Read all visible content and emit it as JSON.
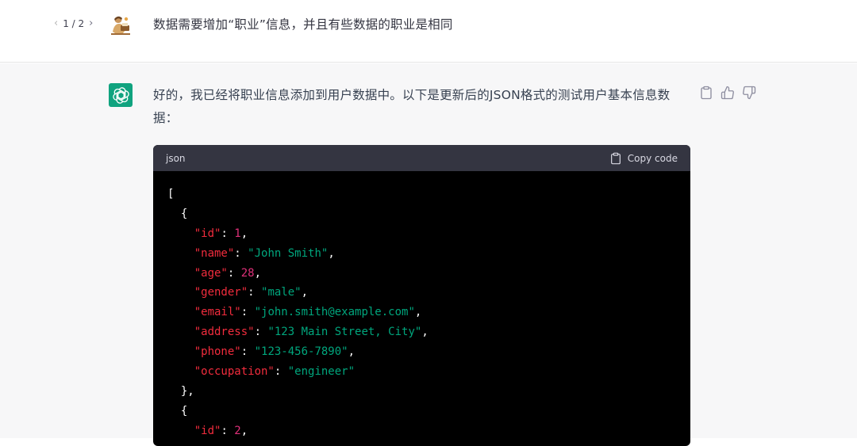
{
  "user_message": {
    "pager": {
      "prev": "‹",
      "label": "1 / 2",
      "next": "›"
    },
    "text": "数据需要增加“职业”信息，并且有些数据的职业是相同"
  },
  "assistant_message": {
    "text": "好的，我已经将职业信息添加到用户数据中。以下是更新后的JSON格式的测试用户基本信息数据：",
    "actions": [
      "clipboard-icon",
      "thumbs-up-icon",
      "thumbs-down-icon"
    ],
    "brand_color": "#10a37f"
  },
  "code_block": {
    "language": "json",
    "copy_label": "Copy code",
    "lines": [
      [
        {
          "t": "p",
          "v": "["
        }
      ],
      [
        {
          "t": "p",
          "v": "  {"
        }
      ],
      [
        {
          "t": "p",
          "v": "    "
        },
        {
          "t": "k",
          "v": "\"id\""
        },
        {
          "t": "p",
          "v": ": "
        },
        {
          "t": "n",
          "v": "1"
        },
        {
          "t": "p",
          "v": ","
        }
      ],
      [
        {
          "t": "p",
          "v": "    "
        },
        {
          "t": "k",
          "v": "\"name\""
        },
        {
          "t": "p",
          "v": ": "
        },
        {
          "t": "s",
          "v": "\"John Smith\""
        },
        {
          "t": "p",
          "v": ","
        }
      ],
      [
        {
          "t": "p",
          "v": "    "
        },
        {
          "t": "k",
          "v": "\"age\""
        },
        {
          "t": "p",
          "v": ": "
        },
        {
          "t": "n",
          "v": "28"
        },
        {
          "t": "p",
          "v": ","
        }
      ],
      [
        {
          "t": "p",
          "v": "    "
        },
        {
          "t": "k",
          "v": "\"gender\""
        },
        {
          "t": "p",
          "v": ": "
        },
        {
          "t": "s",
          "v": "\"male\""
        },
        {
          "t": "p",
          "v": ","
        }
      ],
      [
        {
          "t": "p",
          "v": "    "
        },
        {
          "t": "k",
          "v": "\"email\""
        },
        {
          "t": "p",
          "v": ": "
        },
        {
          "t": "s",
          "v": "\"john.smith@example.com\""
        },
        {
          "t": "p",
          "v": ","
        }
      ],
      [
        {
          "t": "p",
          "v": "    "
        },
        {
          "t": "k",
          "v": "\"address\""
        },
        {
          "t": "p",
          "v": ": "
        },
        {
          "t": "s",
          "v": "\"123 Main Street, City\""
        },
        {
          "t": "p",
          "v": ","
        }
      ],
      [
        {
          "t": "p",
          "v": "    "
        },
        {
          "t": "k",
          "v": "\"phone\""
        },
        {
          "t": "p",
          "v": ": "
        },
        {
          "t": "s",
          "v": "\"123-456-7890\""
        },
        {
          "t": "p",
          "v": ","
        }
      ],
      [
        {
          "t": "p",
          "v": "    "
        },
        {
          "t": "k",
          "v": "\"occupation\""
        },
        {
          "t": "p",
          "v": ": "
        },
        {
          "t": "s",
          "v": "\"engineer\""
        }
      ],
      [
        {
          "t": "p",
          "v": "  },"
        }
      ],
      [
        {
          "t": "p",
          "v": "  {"
        }
      ],
      [
        {
          "t": "p",
          "v": "    "
        },
        {
          "t": "k",
          "v": "\"id\""
        },
        {
          "t": "p",
          "v": ": "
        },
        {
          "t": "n",
          "v": "2"
        },
        {
          "t": "p",
          "v": ","
        }
      ]
    ]
  },
  "colors": {
    "code_key": "#f22c3d",
    "code_string": "#00a67d",
    "code_number": "#df3079",
    "assistant_bg": "#f7f7f8"
  }
}
